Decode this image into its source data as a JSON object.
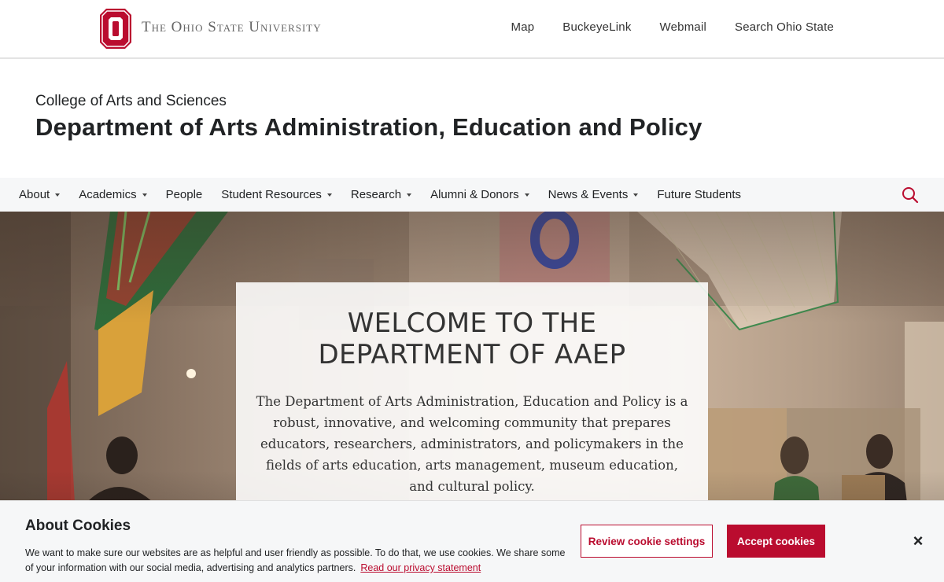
{
  "topbar": {
    "wordmark": "The Ohio State University",
    "logo_icon": "block-o-icon",
    "links": [
      "Map",
      "BuckeyeLink",
      "Webmail",
      "Search Ohio State"
    ]
  },
  "department": {
    "college": "College of Arts and Sciences",
    "title": "Department of Arts Administration, Education and Policy"
  },
  "nav": {
    "items": [
      {
        "label": "About",
        "dropdown": true
      },
      {
        "label": "Academics",
        "dropdown": true
      },
      {
        "label": "People",
        "dropdown": false
      },
      {
        "label": "Student Resources",
        "dropdown": true
      },
      {
        "label": "Research",
        "dropdown": true
      },
      {
        "label": "Alumni & Donors",
        "dropdown": true
      },
      {
        "label": "News & Events",
        "dropdown": true
      },
      {
        "label": "Future Students",
        "dropdown": false
      }
    ],
    "search_icon": "search-icon"
  },
  "hero": {
    "heading": "WELCOME TO THE DEPARTMENT OF AAEP",
    "body": "The Department of Arts Administration, Education and Policy is a robust, innovative, and welcoming community that prepares educators, researchers, administrators, and policymakers in the fields of arts education, arts management, museum education, and cultural policy."
  },
  "cookie": {
    "title": "About Cookies",
    "message": "We want to make sure our websites are as helpful and user friendly as possible. To do that, we use cookies. We share some of your information with our social media, advertising and analytics partners.",
    "privacy_link": "Read our privacy statement",
    "review_label": "Review cookie settings",
    "accept_label": "Accept cookies",
    "close_label": "×"
  },
  "colors": {
    "scarlet": "#ba0c2f",
    "text": "#212325",
    "nav_bg": "#f6f7f8"
  }
}
